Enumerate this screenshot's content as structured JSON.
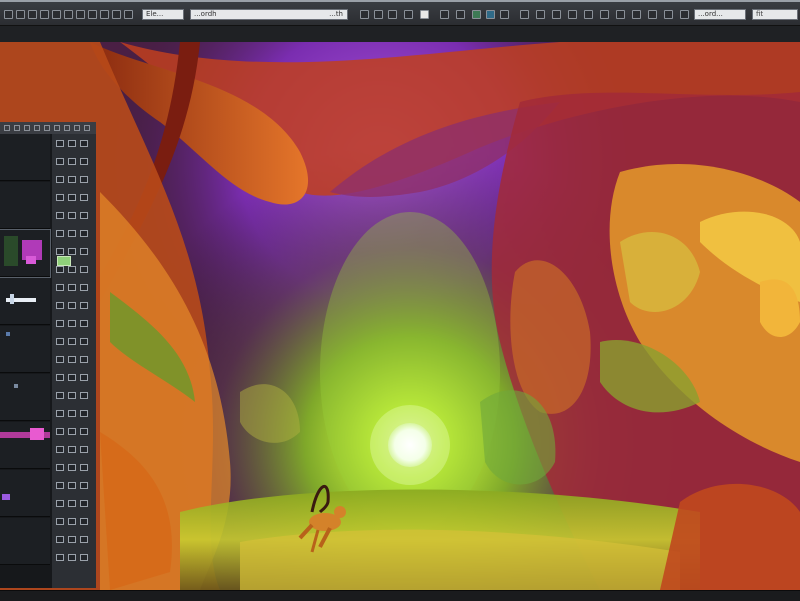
{
  "toolbar": {
    "app_label": "Ele...",
    "path_field": "...ordh",
    "path_field_end": "...th",
    "search_field": "...ord...",
    "search_field_end": "fit"
  },
  "canvas": {
    "artwork": "fantasy-cave-painting"
  },
  "panel": {
    "thumbnails": 8,
    "tool_rows": 24
  },
  "colors": {
    "accent_green": "#c6f23a",
    "accent_magenta": "#c23ad8",
    "accent_orange": "#e5762a"
  }
}
